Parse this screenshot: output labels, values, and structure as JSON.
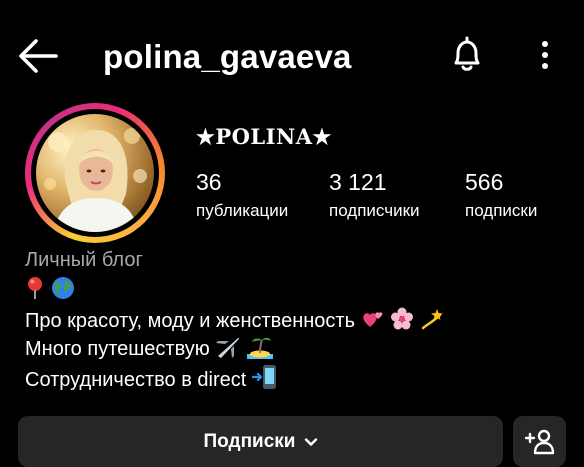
{
  "header": {
    "username": "polina_gavaeva",
    "icons": {
      "back": "arrow-left-icon",
      "notifications": "bell-icon",
      "more": "more-vertical-icon"
    }
  },
  "profile": {
    "display_name": "★POLINA★",
    "avatar": "profile-photo",
    "story_ring_colors": [
      "#f9ce34",
      "#ee2a7b",
      "#c13584",
      "#f58529"
    ]
  },
  "stats": {
    "posts": {
      "value": "36",
      "label": "публикации"
    },
    "followers": {
      "value": "3 121",
      "label": "подписчики"
    },
    "following": {
      "value": "566",
      "label": "подписки"
    }
  },
  "bio": {
    "category": "Личный блог",
    "line1_icons": [
      "round-pushpin-emoji",
      "globe-emoji"
    ],
    "line2_text": "Про красоту, моду и женственность",
    "line2_icons": [
      "two-hearts-emoji",
      "cherry-blossom-emoji",
      "dizzy-emoji"
    ],
    "line3_text": "Много путешествую",
    "line3_icons": [
      "airplane-emoji",
      "desert-island-emoji"
    ],
    "line4_text": "Сотрудничество в direct",
    "line4_icons": [
      "mobile-phone-arrow-emoji"
    ]
  },
  "actions": {
    "follow_label": "Подписки",
    "follow_icon": "chevron-down-icon",
    "suggest_icon": "add-user-icon"
  },
  "colors": {
    "background": "#000000",
    "button": "#262626",
    "category_text": "#a8a8a8"
  }
}
